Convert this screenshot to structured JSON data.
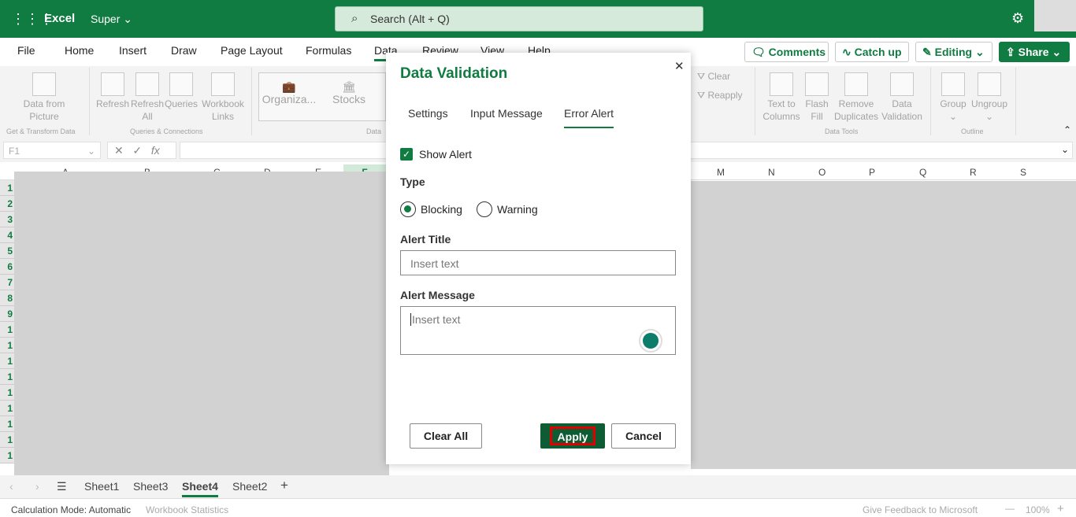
{
  "app": {
    "name": "Excel",
    "doc": "Super",
    "search_placeholder": "Search (Alt + Q)"
  },
  "menu": [
    "File",
    "Home",
    "Insert",
    "Draw",
    "Page Layout",
    "Formulas",
    "Data",
    "Review",
    "View",
    "Help"
  ],
  "header_buttons": {
    "comments": "Comments",
    "catchup": "Catch up",
    "editing": "Editing",
    "share": "Share"
  },
  "ribbon": {
    "data_from_picture": "Data from Picture",
    "refresh": "Refresh",
    "refresh_all": "Refresh All",
    "queries": "Queries",
    "workbook_links": "Workbook Links",
    "organiza": "Organiza...",
    "stocks": "Stocks",
    "clear": "Clear",
    "reapply": "Reapply",
    "text_to_columns": "Text to Columns",
    "flash_fill": "Flash Fill",
    "remove_duplicates": "Remove Duplicates",
    "data_validation": "Data Validation",
    "group": "Group",
    "ungroup": "Ungroup",
    "groups": {
      "get": "Get & Transform Data",
      "queries": "Queries & Connections",
      "data": "Data",
      "tools": "Data Tools",
      "outline": "Outline"
    }
  },
  "namebox": "F1",
  "columns_left": [
    "A",
    "B",
    "C",
    "D",
    "E",
    "F"
  ],
  "columns_right": [
    "M",
    "N",
    "O",
    "P",
    "Q",
    "R",
    "S"
  ],
  "rows": [
    "1",
    "2",
    "3",
    "4",
    "5",
    "6",
    "7",
    "8",
    "9",
    "1",
    "1",
    "1",
    "1",
    "1",
    "1",
    "1",
    "1",
    "1"
  ],
  "sheets": [
    "Sheet1",
    "Sheet3",
    "Sheet4",
    "Sheet2"
  ],
  "active_sheet": "Sheet4",
  "status": {
    "calc": "Calculation Mode: Automatic",
    "stats": "Workbook Statistics",
    "feedback": "Give Feedback to Microsoft",
    "zoom": "100%"
  },
  "dialog": {
    "title": "Data Validation",
    "tabs": [
      "Settings",
      "Input Message",
      "Error Alert"
    ],
    "active_tab": "Error Alert",
    "show_alert": "Show Alert",
    "show_alert_checked": true,
    "type_label": "Type",
    "blocking": "Blocking",
    "warning": "Warning",
    "selected_type": "Blocking",
    "alert_title_label": "Alert Title",
    "alert_title_placeholder": "Insert text",
    "alert_message_label": "Alert Message",
    "alert_message_placeholder": "Insert text",
    "clear_all": "Clear All",
    "apply": "Apply",
    "cancel": "Cancel"
  },
  "colors": {
    "brand": "#107c41",
    "apply_bg": "#0e5c33",
    "highlight": "#e00000"
  }
}
